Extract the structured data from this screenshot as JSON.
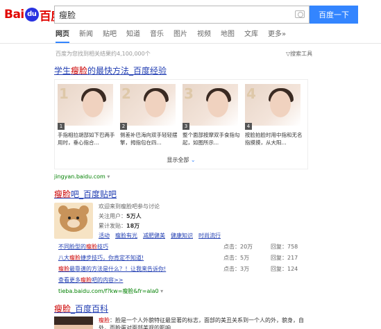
{
  "header": {
    "logo_prefix": "Bai",
    "logo_paw": "du",
    "logo_suffix": "百度",
    "query": "瘦脸",
    "search_button": "百度一下"
  },
  "tabs": [
    {
      "label": "网页",
      "active": true
    },
    {
      "label": "新闻"
    },
    {
      "label": "贴吧"
    },
    {
      "label": "知道"
    },
    {
      "label": "音乐"
    },
    {
      "label": "图片"
    },
    {
      "label": "视频"
    },
    {
      "label": "地图"
    },
    {
      "label": "文库"
    },
    {
      "label": "更多»"
    }
  ],
  "result_count": "百度为您找到相关结果约4,100,000个",
  "search_tools": "搜索工具",
  "result1": {
    "title_pre": "学生",
    "title_em": "瘦脸",
    "title_post": "的最快方法_百度经验",
    "steps": [
      {
        "n": "1",
        "desc": "手指相拉胡部如下巴两手用时，垂心指合..."
      },
      {
        "n": "2",
        "desc": "侧差补巴海向双手轻轻摆擎，拇指包在四..."
      },
      {
        "n": "3",
        "desc": "整个面部按摩双手食指勾起，如图所示..."
      },
      {
        "n": "4",
        "desc": "按脸拍脸时用中指和无名指摸摸，从大阳..."
      }
    ],
    "show_all": "显示全部",
    "url": "jingyan.baidu.com"
  },
  "result2": {
    "title_em": "瘦脸",
    "title_post": "吧_百度贴吧",
    "welcome": "欢迎来到瘦脸吧参与讨论",
    "members_label": "关注用户：",
    "members": "5万人",
    "posts_label": "累计发贴：",
    "posts": "18万",
    "links": [
      "活动",
      "瘦脸有光",
      "减肥健美",
      "健康知识",
      "时尚流行"
    ],
    "threads": [
      {
        "pre": "不同脸型的",
        "em": "瘦脸",
        "post": "技巧",
        "clicks": "点击：20万",
        "replies": "回复：758"
      },
      {
        "pre": "八大",
        "em": "瘦脸",
        "post": "捷步技巧，你肯定不知道!",
        "clicks": "点击：5万",
        "replies": "回复：217"
      },
      {
        "pre": "",
        "em": "瘦脸",
        "post": "最靠谱的方法是什么？！让我来告诉你!",
        "clicks": "点击：3万",
        "replies": "回复：124"
      }
    ],
    "more_pre": "查看更多",
    "more_em": "瘦脸",
    "more_post": "吧的内容>>",
    "url": "tieba.baidu.com/f?kw=瘦脸&fr=ala0"
  },
  "result3": {
    "title_em": "瘦脸",
    "title_post": "_百度百科",
    "text_em": "瘦脸",
    "text_post": "：脸是一个人外貌特征最显著的标志，面部的美丑关系到一个人的外，貌身，自处，而脸蛋对面部美观的影响..."
  }
}
